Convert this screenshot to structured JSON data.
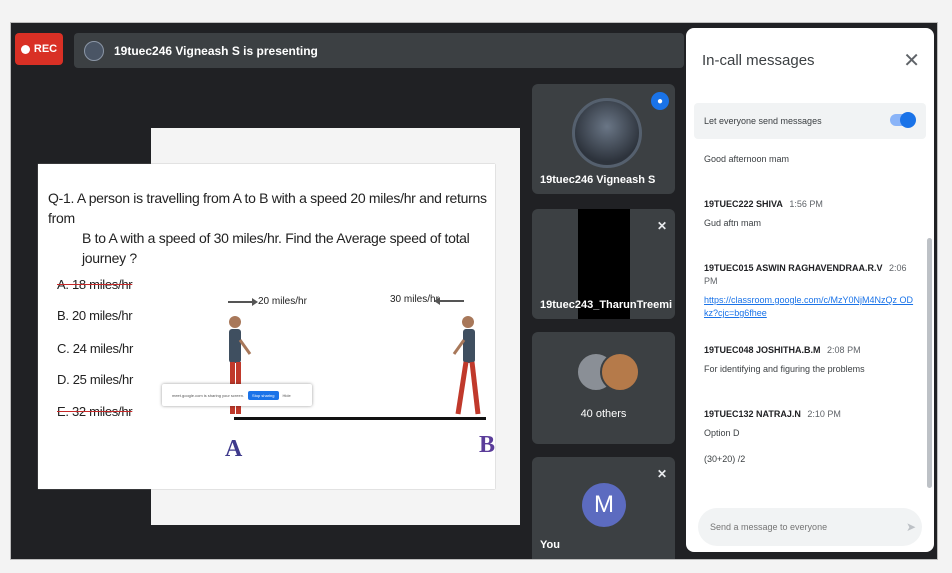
{
  "top": {
    "rec_label": "REC",
    "presenting_text": "19tuec246 Vigneash S is presenting"
  },
  "slide": {
    "question_line1": "Q-1. A person is travelling from A to B with a speed 20 miles/hr and returns from",
    "question_line2": "B to A with a speed of 30 miles/hr. Find the Average speed of total journey ?",
    "options": [
      {
        "text": "A. 18 miles/hr",
        "struck": true
      },
      {
        "text": "B. 20 miles/hr",
        "struck": false
      },
      {
        "text": "C. 24 miles/hr",
        "struck": false
      },
      {
        "text": "D. 25 miles/hr",
        "struck": false
      },
      {
        "text": "E. 32 miles/hr",
        "struck": true
      }
    ],
    "speed_left": "20 miles/hr",
    "speed_right": "30 miles/hr",
    "point_a": "A",
    "point_b": "B",
    "share_text": "meet.google.com is sharing your screen.",
    "stop_sharing": "Stop sharing",
    "hide": "Hide"
  },
  "participants": [
    {
      "name": "19tuec246 Vigneash S",
      "state": "speaking"
    },
    {
      "name": "19tuec243_TharunTreemi",
      "state": "muted"
    },
    {
      "name": "40 others"
    },
    {
      "name": "You",
      "initial": "M",
      "state": "muted"
    }
  ],
  "panel": {
    "title": "In-call messages",
    "toggle_label": "Let everyone send messages",
    "toggle_on": true,
    "messages": [
      {
        "sender": "",
        "time": "",
        "body": "Good afternoon mam"
      },
      {
        "sender": "19TUEC222 SHIVA",
        "time": "1:56 PM",
        "body": "Gud aftn mam"
      },
      {
        "sender": "19TUEC015 ASWIN RAGHAVENDRAA.R.V",
        "time": "2:06 PM",
        "body": "https://classroom.google.com/c/MzY0NjM4NzQz ODkz?cjc=bg6fhee",
        "link": true
      },
      {
        "sender": "19TUEC048 JOSHITHA.B.M",
        "time": "2:08 PM",
        "body": "For identifying and figuring the problems"
      },
      {
        "sender": "19TUEC132 NATRAJ.N",
        "time": "2:10 PM",
        "body": "Option D"
      },
      {
        "sender": "",
        "time": "",
        "body": "(30+20) /2"
      }
    ],
    "composer_placeholder": "Send a message to everyone"
  },
  "colors": {
    "rec": "#d93025",
    "accent": "#1a73e8",
    "dark_bg": "#202124",
    "tile_bg": "#3c4043",
    "strike": "#c62828",
    "point_a": "#3f3a8c",
    "point_b": "#5b3d9a"
  }
}
